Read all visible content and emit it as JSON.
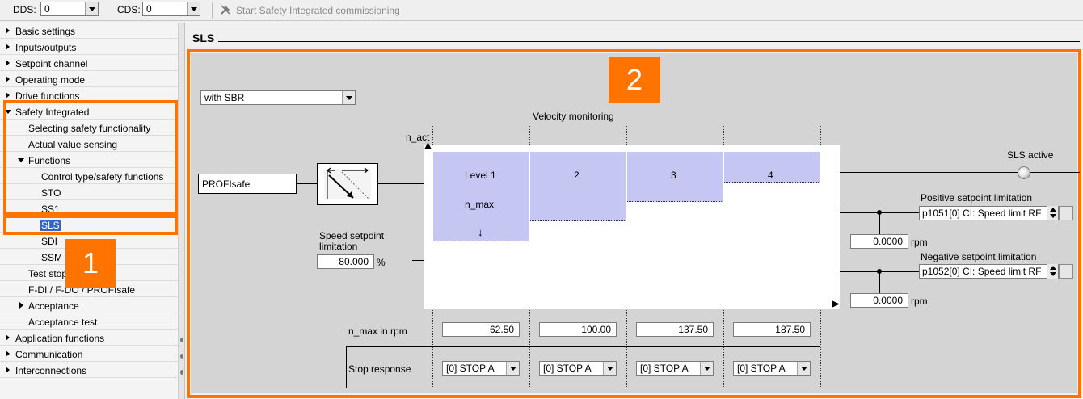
{
  "toolbar": {
    "dds_label": "DDS:",
    "dds_value": "0",
    "cds_label": "CDS:",
    "cds_value": "0",
    "commission_label": "Start Safety Integrated commissioning",
    "commission_icon": "wrench-hammer-icon"
  },
  "tree": {
    "items": [
      {
        "label": "Basic settings"
      },
      {
        "label": "Inputs/outputs"
      },
      {
        "label": "Setpoint channel"
      },
      {
        "label": "Operating mode"
      },
      {
        "label": "Drive functions"
      },
      {
        "label": "Safety Integrated"
      },
      {
        "label": "Selecting safety functionality"
      },
      {
        "label": "Actual value sensing"
      },
      {
        "label": "Functions"
      },
      {
        "label": "Control type/safety functions"
      },
      {
        "label": "STO"
      },
      {
        "label": "SS1"
      },
      {
        "label": "SLS"
      },
      {
        "label": "SDI"
      },
      {
        "label": "SSM"
      },
      {
        "label": "Test stop"
      },
      {
        "label": "F-DI / F-DO / PROFIsafe"
      },
      {
        "label": "Acceptance"
      },
      {
        "label": "Acceptance test"
      },
      {
        "label": "Application functions"
      },
      {
        "label": "Communication"
      },
      {
        "label": "Interconnections"
      }
    ],
    "selected": "SLS"
  },
  "badges": {
    "one": "1",
    "two": "2"
  },
  "colors": {
    "highlight": "#ff7300",
    "level_fill": "#c6c6f2",
    "selection": "#3267c8"
  },
  "main": {
    "title": "SLS",
    "mode_select": "with SBR",
    "velocity_monitoring": "Velocity monitoring",
    "n_act": "n_act",
    "profisafe": "PROFIsafe",
    "speed_setpoint_label": "Speed setpoint limitation",
    "speed_setpoint_value": "80.000",
    "speed_setpoint_unit": "%",
    "levels": [
      "Level 1",
      "2",
      "3",
      "4"
    ],
    "n_max_label": "n_max",
    "n_max_arrow": "↓",
    "sls_active": "SLS active",
    "positive_label": "Positive setpoint limitation",
    "positive_param": "p1051[0] CI: Speed limit RF",
    "positive_value": "0.0000",
    "negative_label": "Negative setpoint limitation",
    "negative_param": "p1052[0] CI: Speed limit RF",
    "negative_value": "0.0000",
    "rpm": "rpm",
    "n_max_rpm_label": "n_max in rpm",
    "n_max_values": [
      "62.50",
      "100.00",
      "137.50",
      "187.50"
    ],
    "stop_response_label": "Stop response",
    "stop_responses": [
      "[0] STOP A",
      "[0] STOP A",
      "[0] STOP A",
      "[0] STOP A"
    ]
  }
}
